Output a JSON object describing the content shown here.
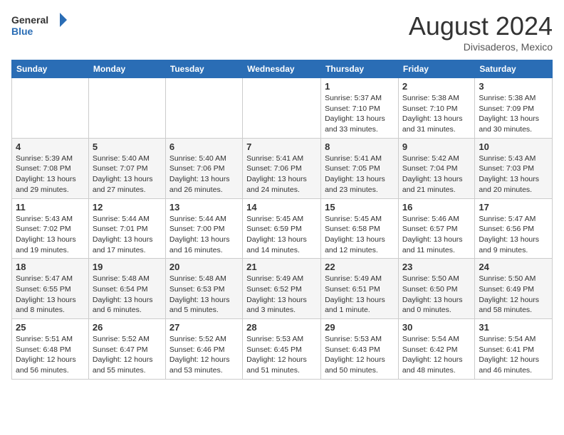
{
  "header": {
    "logo_general": "General",
    "logo_blue": "Blue",
    "month_title": "August 2024",
    "location": "Divisaderos, Mexico"
  },
  "days_of_week": [
    "Sunday",
    "Monday",
    "Tuesday",
    "Wednesday",
    "Thursday",
    "Friday",
    "Saturday"
  ],
  "weeks": [
    [
      {
        "day": "",
        "info": ""
      },
      {
        "day": "",
        "info": ""
      },
      {
        "day": "",
        "info": ""
      },
      {
        "day": "",
        "info": ""
      },
      {
        "day": "1",
        "info": "Sunrise: 5:37 AM\nSunset: 7:10 PM\nDaylight: 13 hours\nand 33 minutes."
      },
      {
        "day": "2",
        "info": "Sunrise: 5:38 AM\nSunset: 7:10 PM\nDaylight: 13 hours\nand 31 minutes."
      },
      {
        "day": "3",
        "info": "Sunrise: 5:38 AM\nSunset: 7:09 PM\nDaylight: 13 hours\nand 30 minutes."
      }
    ],
    [
      {
        "day": "4",
        "info": "Sunrise: 5:39 AM\nSunset: 7:08 PM\nDaylight: 13 hours\nand 29 minutes."
      },
      {
        "day": "5",
        "info": "Sunrise: 5:40 AM\nSunset: 7:07 PM\nDaylight: 13 hours\nand 27 minutes."
      },
      {
        "day": "6",
        "info": "Sunrise: 5:40 AM\nSunset: 7:06 PM\nDaylight: 13 hours\nand 26 minutes."
      },
      {
        "day": "7",
        "info": "Sunrise: 5:41 AM\nSunset: 7:06 PM\nDaylight: 13 hours\nand 24 minutes."
      },
      {
        "day": "8",
        "info": "Sunrise: 5:41 AM\nSunset: 7:05 PM\nDaylight: 13 hours\nand 23 minutes."
      },
      {
        "day": "9",
        "info": "Sunrise: 5:42 AM\nSunset: 7:04 PM\nDaylight: 13 hours\nand 21 minutes."
      },
      {
        "day": "10",
        "info": "Sunrise: 5:43 AM\nSunset: 7:03 PM\nDaylight: 13 hours\nand 20 minutes."
      }
    ],
    [
      {
        "day": "11",
        "info": "Sunrise: 5:43 AM\nSunset: 7:02 PM\nDaylight: 13 hours\nand 19 minutes."
      },
      {
        "day": "12",
        "info": "Sunrise: 5:44 AM\nSunset: 7:01 PM\nDaylight: 13 hours\nand 17 minutes."
      },
      {
        "day": "13",
        "info": "Sunrise: 5:44 AM\nSunset: 7:00 PM\nDaylight: 13 hours\nand 16 minutes."
      },
      {
        "day": "14",
        "info": "Sunrise: 5:45 AM\nSunset: 6:59 PM\nDaylight: 13 hours\nand 14 minutes."
      },
      {
        "day": "15",
        "info": "Sunrise: 5:45 AM\nSunset: 6:58 PM\nDaylight: 13 hours\nand 12 minutes."
      },
      {
        "day": "16",
        "info": "Sunrise: 5:46 AM\nSunset: 6:57 PM\nDaylight: 13 hours\nand 11 minutes."
      },
      {
        "day": "17",
        "info": "Sunrise: 5:47 AM\nSunset: 6:56 PM\nDaylight: 13 hours\nand 9 minutes."
      }
    ],
    [
      {
        "day": "18",
        "info": "Sunrise: 5:47 AM\nSunset: 6:55 PM\nDaylight: 13 hours\nand 8 minutes."
      },
      {
        "day": "19",
        "info": "Sunrise: 5:48 AM\nSunset: 6:54 PM\nDaylight: 13 hours\nand 6 minutes."
      },
      {
        "day": "20",
        "info": "Sunrise: 5:48 AM\nSunset: 6:53 PM\nDaylight: 13 hours\nand 5 minutes."
      },
      {
        "day": "21",
        "info": "Sunrise: 5:49 AM\nSunset: 6:52 PM\nDaylight: 13 hours\nand 3 minutes."
      },
      {
        "day": "22",
        "info": "Sunrise: 5:49 AM\nSunset: 6:51 PM\nDaylight: 13 hours\nand 1 minute."
      },
      {
        "day": "23",
        "info": "Sunrise: 5:50 AM\nSunset: 6:50 PM\nDaylight: 13 hours\nand 0 minutes."
      },
      {
        "day": "24",
        "info": "Sunrise: 5:50 AM\nSunset: 6:49 PM\nDaylight: 12 hours\nand 58 minutes."
      }
    ],
    [
      {
        "day": "25",
        "info": "Sunrise: 5:51 AM\nSunset: 6:48 PM\nDaylight: 12 hours\nand 56 minutes."
      },
      {
        "day": "26",
        "info": "Sunrise: 5:52 AM\nSunset: 6:47 PM\nDaylight: 12 hours\nand 55 minutes."
      },
      {
        "day": "27",
        "info": "Sunrise: 5:52 AM\nSunset: 6:46 PM\nDaylight: 12 hours\nand 53 minutes."
      },
      {
        "day": "28",
        "info": "Sunrise: 5:53 AM\nSunset: 6:45 PM\nDaylight: 12 hours\nand 51 minutes."
      },
      {
        "day": "29",
        "info": "Sunrise: 5:53 AM\nSunset: 6:43 PM\nDaylight: 12 hours\nand 50 minutes."
      },
      {
        "day": "30",
        "info": "Sunrise: 5:54 AM\nSunset: 6:42 PM\nDaylight: 12 hours\nand 48 minutes."
      },
      {
        "day": "31",
        "info": "Sunrise: 5:54 AM\nSunset: 6:41 PM\nDaylight: 12 hours\nand 46 minutes."
      }
    ]
  ]
}
